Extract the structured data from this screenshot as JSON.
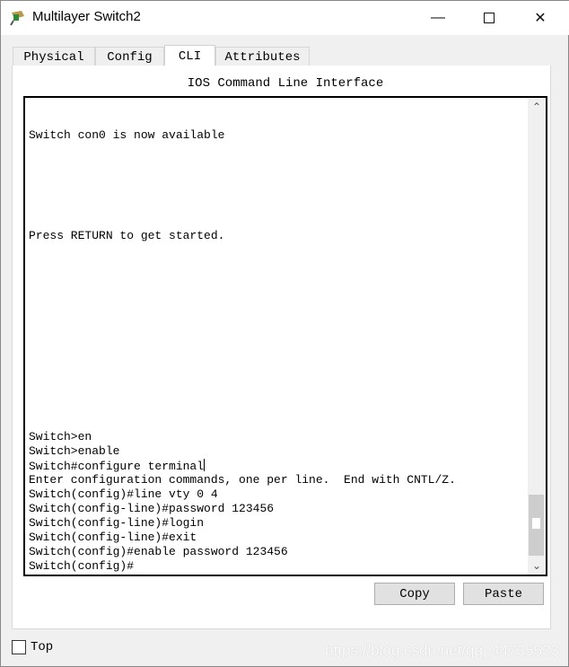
{
  "window": {
    "title": "Multilayer Switch2",
    "minimize_icon": "minimize-icon",
    "maximize_icon": "maximize-icon",
    "close_icon": "close-icon"
  },
  "tabs": [
    {
      "label": "Physical"
    },
    {
      "label": "Config"
    },
    {
      "label": "CLI",
      "active": true
    },
    {
      "label": "Attributes"
    }
  ],
  "cli": {
    "heading": "IOS Command Line Interface",
    "lines": [
      "",
      "",
      "Switch con0 is now available",
      "",
      "",
      "",
      "",
      "",
      "",
      "Press RETURN to get started.",
      "",
      "",
      "",
      "",
      "",
      "",
      "",
      "",
      "",
      "",
      "",
      "",
      "",
      "Switch>en",
      "Switch>enable",
      "Switch#configure terminal",
      "Enter configuration commands, one per line.  End with CNTL/Z.",
      "Switch(config)#line vty 0 4",
      "Switch(config-line)#password 123456",
      "Switch(config-line)#login",
      "Switch(config-line)#exit",
      "Switch(config)#enable password 123456",
      "Switch(config)#"
    ]
  },
  "buttons": {
    "copy": "Copy",
    "paste": "Paste"
  },
  "footer": {
    "top_label": "Top",
    "top_checked": false,
    "watermark": "https://blog.csdn.net/qq_44735533"
  }
}
